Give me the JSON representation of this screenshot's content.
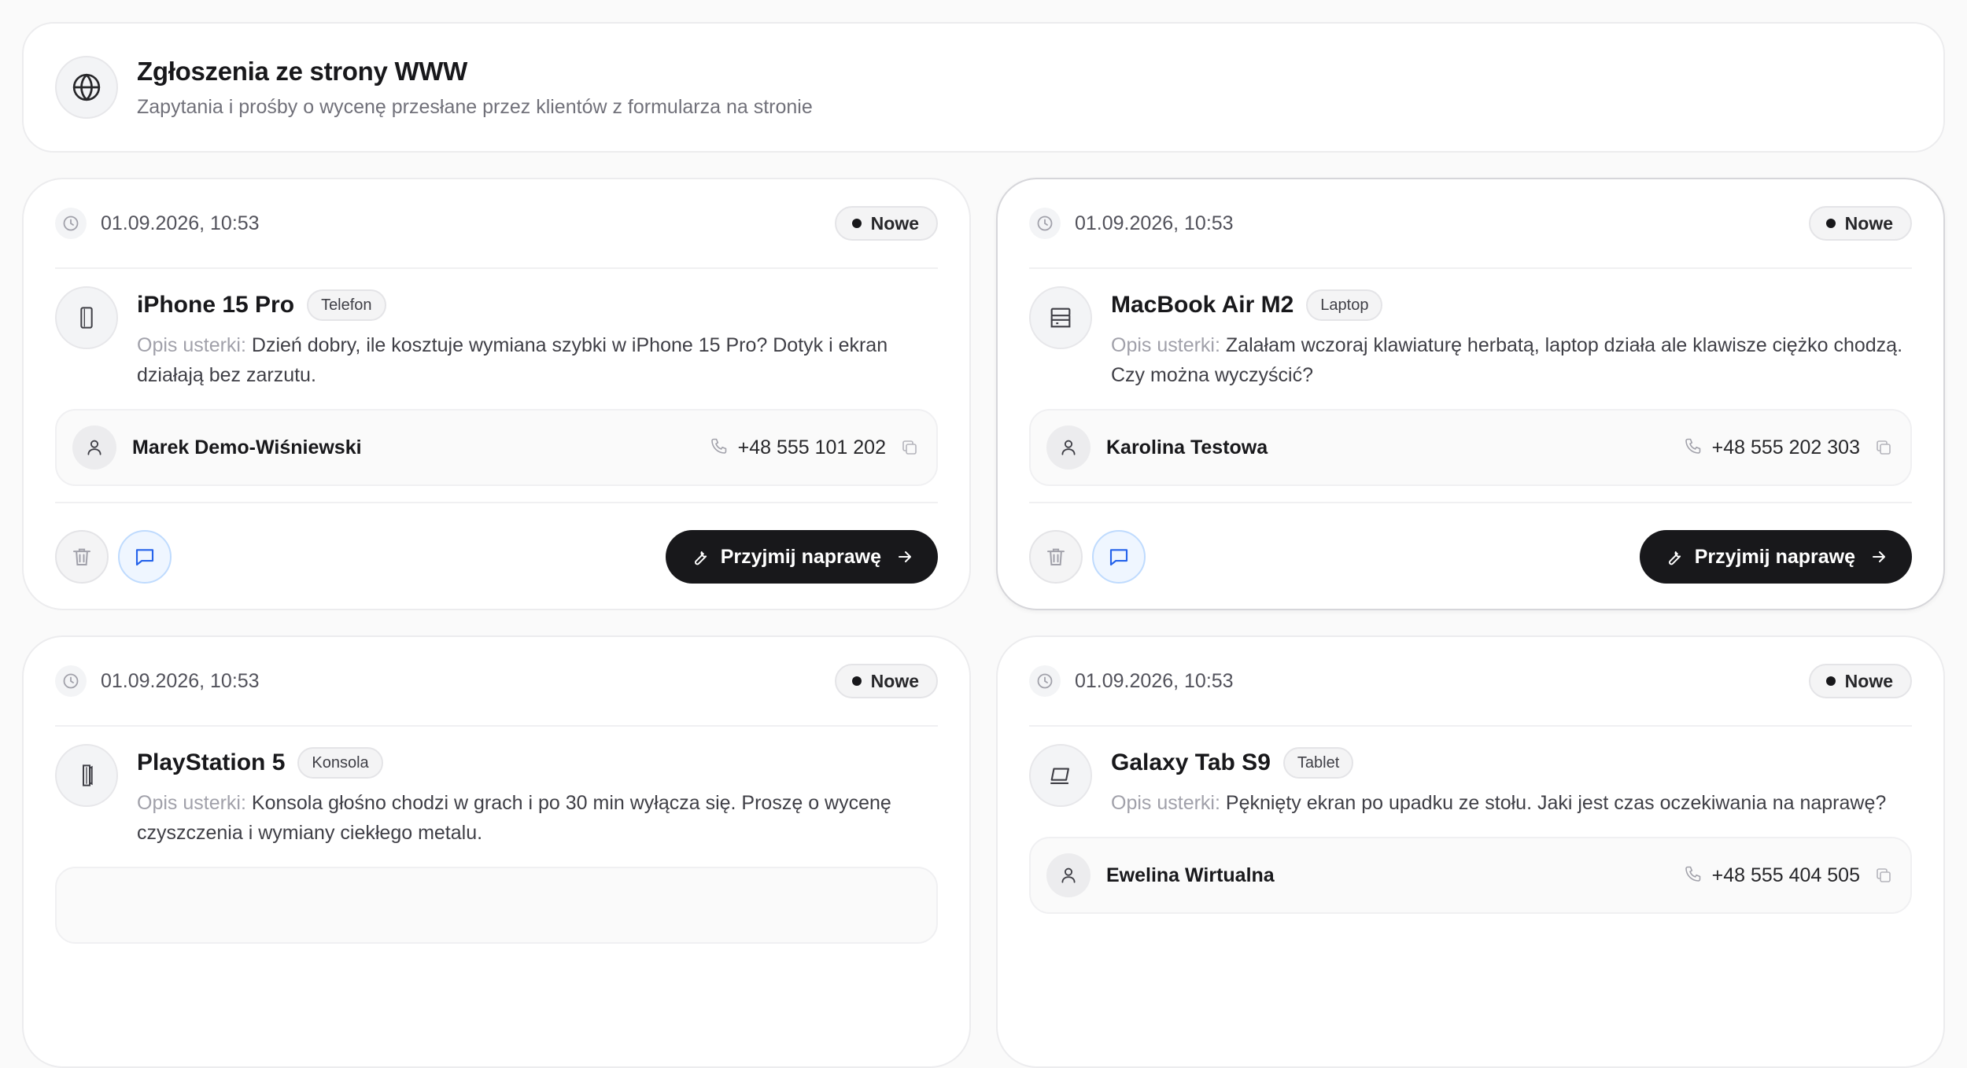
{
  "header": {
    "title": "Zgłoszenia ze strony WWW",
    "subtitle": "Zapytania i prośby o wycenę przesłane przez klientów z formularza na stronie",
    "icon": "globe-icon"
  },
  "labels": {
    "description_prefix": "Opis usterki:",
    "accept_button": "Przyjmij naprawę"
  },
  "colors": {
    "primary_dark": "#18181b",
    "message_accent": "#2563eb",
    "muted": "#71717a"
  },
  "requests": [
    {
      "date": "01.09.2026, 10:53",
      "status": "Nowe",
      "device": "iPhone 15 Pro",
      "category": "Telefon",
      "device_icon": "smartphone-icon",
      "description": "Dzień dobry, ile kosztuje wymiana szybki w iPhone 15 Pro? Dotyk i ekran działają bez zarzutu.",
      "client": "Marek Demo-Wiśniewski",
      "phone": "+48 555 101 202"
    },
    {
      "date": "01.09.2026, 10:53",
      "status": "Nowe",
      "device": "MacBook Air M2",
      "category": "Laptop",
      "device_icon": "laptop-icon",
      "description": "Zalałam wczoraj klawiaturę herbatą, laptop działa ale klawisze ciężko chodzą. Czy można wyczyścić?",
      "client": "Karolina Testowa",
      "phone": "+48 555 202 303"
    },
    {
      "date": "01.09.2026, 10:53",
      "status": "Nowe",
      "device": "PlayStation 5",
      "category": "Konsola",
      "device_icon": "console-icon",
      "description": "Konsola głośno chodzi w grach i po 30 min wyłącza się. Proszę o wycenę czyszczenia i wymiany ciekłego metalu.",
      "client": "",
      "phone": ""
    },
    {
      "date": "01.09.2026, 10:53",
      "status": "Nowe",
      "device": "Galaxy Tab S9",
      "category": "Tablet",
      "device_icon": "tablet-icon",
      "description": "Pęknięty ekran po upadku ze stołu. Jaki jest czas oczekiwania na naprawę?",
      "client": "Ewelina Wirtualna",
      "phone": "+48 555 404 505"
    }
  ]
}
